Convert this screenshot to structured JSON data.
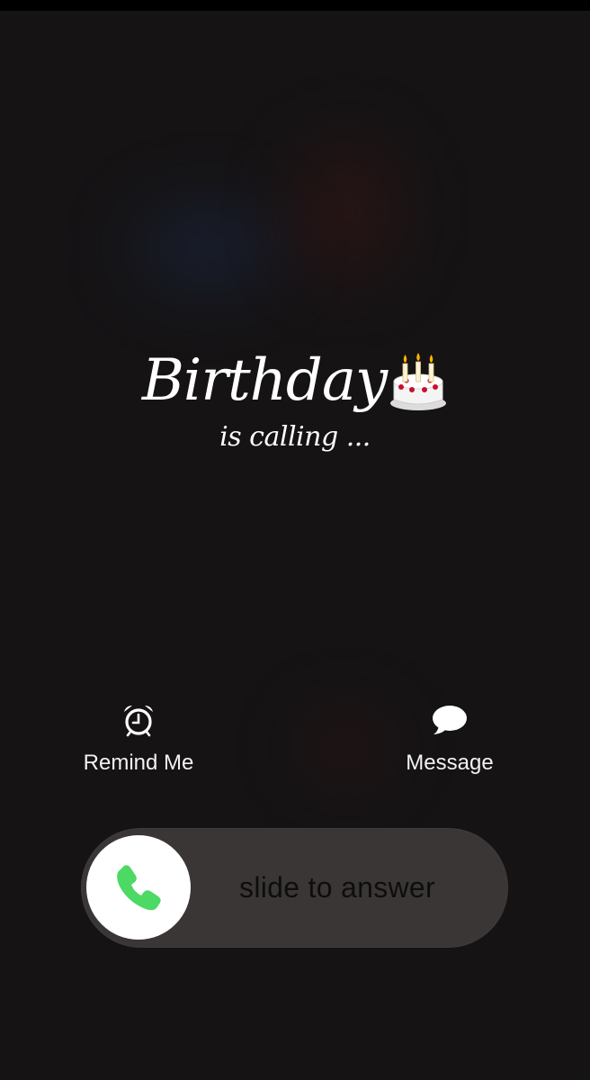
{
  "call": {
    "caller_name": "Birthday",
    "caller_emoji": "cake-icon",
    "status": "is calling ..."
  },
  "actions": {
    "remind": {
      "label": "Remind Me",
      "icon": "alarm-clock-icon"
    },
    "message": {
      "label": "Message",
      "icon": "speech-bubble-icon"
    }
  },
  "slider": {
    "label": "slide to answer",
    "thumb_icon": "phone-icon",
    "thumb_icon_color": "#4cd964"
  },
  "colors": {
    "background": "#151314",
    "slider_track": "#3b3636",
    "text": "#ffffff"
  }
}
